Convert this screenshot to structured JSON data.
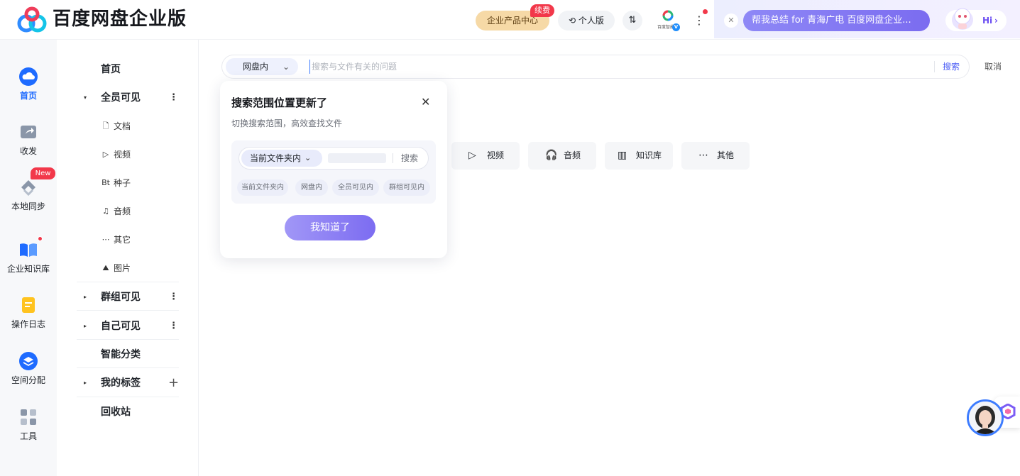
{
  "app": {
    "title": "百度网盘企业版"
  },
  "header": {
    "enterprise_center": "企业产品中心",
    "renew_badge": "续费",
    "personal_label": "个人版",
    "transfer_label": "⇅",
    "company_label": "百度智能",
    "more_label": "⋮",
    "ai_close": "✕",
    "ai_prompt": "帮我总结 for 青海广电 百度网盘企业...",
    "hi_label": "Hi",
    "hi_arrow": "›"
  },
  "rail": {
    "items": [
      {
        "label": "首页",
        "icon": "cloud-icon"
      },
      {
        "label": "收发",
        "icon": "share-folder-icon"
      },
      {
        "label": "本地同步",
        "icon": "sync-icon"
      },
      {
        "label": "企业知识库",
        "icon": "book-icon"
      },
      {
        "label": "操作日志",
        "icon": "log-icon"
      },
      {
        "label": "空间分配",
        "icon": "layers-icon"
      },
      {
        "label": "工具",
        "icon": "apps-icon"
      }
    ],
    "new_badge": "New"
  },
  "tree": {
    "home": "首页",
    "all_visible": "全员可见",
    "sub": [
      {
        "icon": "🗋",
        "label": "文档"
      },
      {
        "icon": "▷",
        "label": "视频"
      },
      {
        "icon": "Bt",
        "label": "种子"
      },
      {
        "icon": "♫",
        "label": "音频"
      },
      {
        "icon": "⋯",
        "label": "其它"
      },
      {
        "icon": "⛰",
        "label": "图片"
      }
    ],
    "group_visible": "群组可见",
    "self_visible": "自己可见",
    "smart_category": "智能分类",
    "my_tags": "我的标签",
    "recycle_bin": "回收站",
    "caret": "▸",
    "caret_open": "▾",
    "kebab": "⋮",
    "plus": "+"
  },
  "search": {
    "scope": "网盘内",
    "placeholder": "搜索与文件有关的问题",
    "value": "",
    "search_label": "搜索",
    "cancel_label": "取消",
    "chevron": "⌄"
  },
  "categories": [
    {
      "icon": "▷",
      "label": "视频"
    },
    {
      "icon": "🎧",
      "label": "音频"
    },
    {
      "icon": "▥",
      "label": "知识库"
    },
    {
      "icon": "⋯",
      "label": "其他"
    }
  ],
  "popup": {
    "title": "搜索范围位置更新了",
    "close": "✕",
    "subtitle": "切换搜索范围，高效查找文件",
    "demo_scope": "当前文件夹内",
    "demo_chevron": "⌄",
    "demo_search": "搜索",
    "chips": [
      "当前文件夹内",
      "网盘内",
      "全员可见内",
      "群组可见内"
    ],
    "ok_label": "我知道了"
  },
  "colors": {
    "accent": "#1e6bff",
    "primary_purple": "#7c6cf1",
    "badge_red": "#f2384a",
    "enterprise_gold": "#f6d9a6"
  }
}
